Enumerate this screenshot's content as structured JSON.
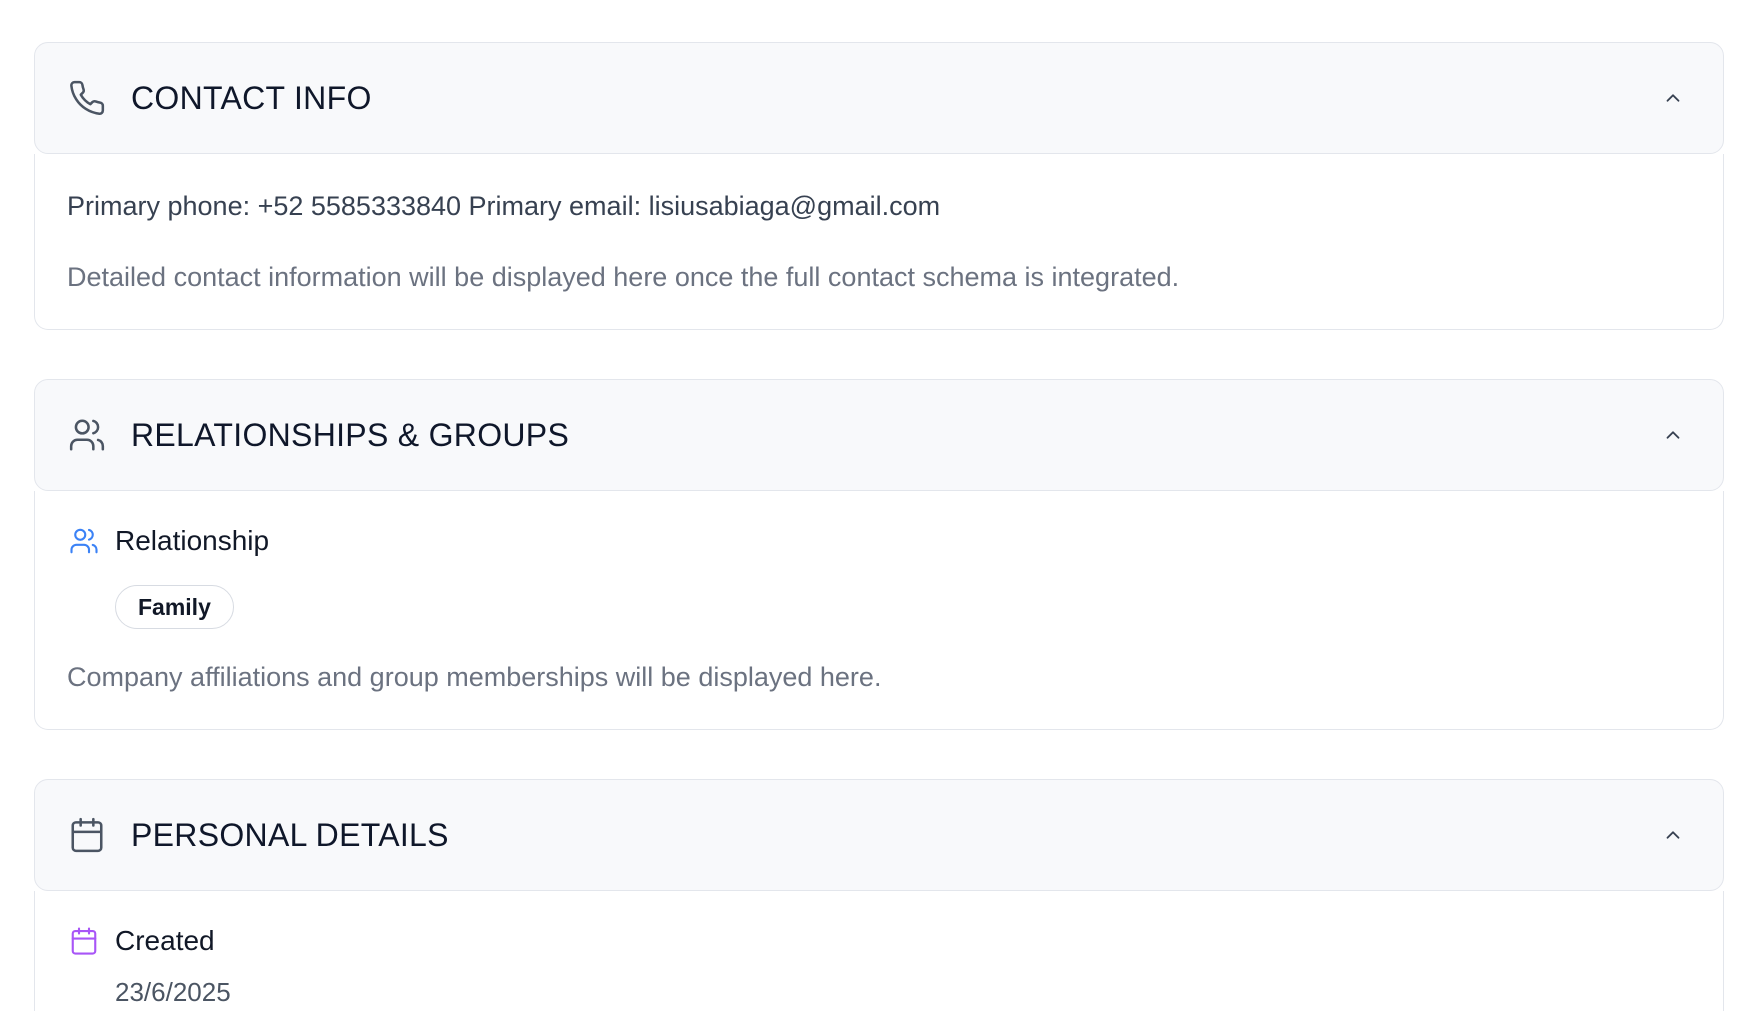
{
  "sections": {
    "contact": {
      "title": "CONTACT INFO",
      "icon": "phone-icon",
      "summary": "Primary phone: +52 5585333840 Primary email: lisiusabiaga@gmail.com",
      "note": "Detailed contact information will be displayed here once the full contact schema is integrated."
    },
    "relationships": {
      "title": "RELATIONSHIPS & GROUPS",
      "icon": "users-icon",
      "field_label": "Relationship",
      "field_icon": "users-icon",
      "badge": "Family",
      "note": "Company affiliations and group memberships will be displayed here."
    },
    "personal": {
      "title": "PERSONAL DETAILS",
      "icon": "calendar-icon",
      "field_label": "Created",
      "field_icon": "calendar-icon",
      "value": "23/6/2025"
    }
  },
  "colors": {
    "header_bg": "#f8f9fb",
    "border": "#e3e6ec",
    "relationship_icon": "#3b82f6",
    "created_icon": "#a855f7"
  }
}
